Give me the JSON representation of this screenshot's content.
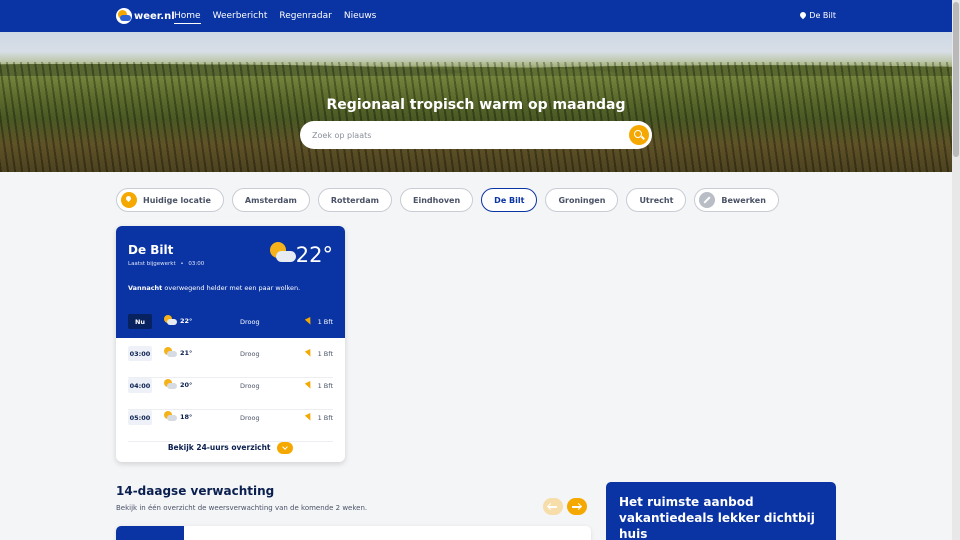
{
  "nav": {
    "logo_text": "weer.nl",
    "links": [
      "Home",
      "Weerbericht",
      "Regenradar",
      "Nieuws"
    ],
    "active_link": "Home",
    "location": "De Bilt"
  },
  "hero": {
    "title": "Regionaal tropisch warm op maandag",
    "search_placeholder": "Zoek op plaats"
  },
  "chips": [
    {
      "label": "Huidige locatie",
      "icon": "location-pin-icon"
    },
    {
      "label": "Amsterdam"
    },
    {
      "label": "Rotterdam"
    },
    {
      "label": "Eindhoven"
    },
    {
      "label": "De Bilt",
      "active": true
    },
    {
      "label": "Groningen"
    },
    {
      "label": "Utrecht"
    },
    {
      "label": "Bewerken",
      "icon": "pencil-icon"
    }
  ],
  "weather_card": {
    "city": "De Bilt",
    "updated_label": "Laatst bijgewerkt",
    "updated_sep": "•",
    "updated_time": "03:00",
    "temperature": "22°",
    "icon": "partly-cloudy-icon",
    "desc_bold": "Vannacht",
    "desc_rest": "overwegend helder met een paar wolken.",
    "now": {
      "time": "Nu",
      "temp": "22°",
      "precip": "Droog",
      "wind": "1 Bft"
    },
    "hours": [
      {
        "time": "03:00",
        "temp": "21°",
        "precip": "Droog",
        "wind": "1 Bft"
      },
      {
        "time": "04:00",
        "temp": "20°",
        "precip": "Droog",
        "wind": "1 Bft"
      },
      {
        "time": "05:00",
        "temp": "18°",
        "precip": "Droog",
        "wind": "1 Bft"
      }
    ],
    "more_label": "Bekijk 24-uurs overzicht"
  },
  "forecast": {
    "title": "14-daagse verwachting",
    "subtitle": "Bekijk in één overzicht de weersverwachting van de komende 2 weken."
  },
  "promo": {
    "text": "Het ruimste aanbod vakantiedeals lekker dichtbij huis"
  },
  "colors": {
    "brand_blue": "#0a33a3",
    "accent_orange": "#f5a800",
    "dark_navy": "#08215f"
  }
}
